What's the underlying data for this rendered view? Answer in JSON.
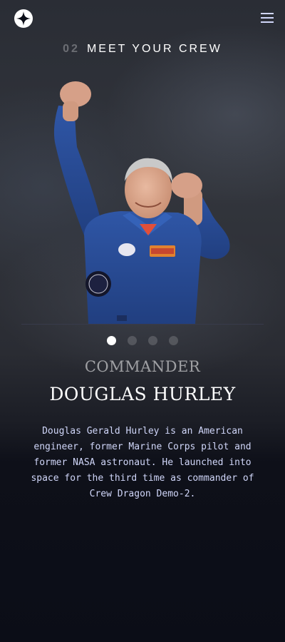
{
  "header": {
    "logo_icon": "star-logo-icon",
    "menu_icon": "hamburger-menu-icon"
  },
  "section": {
    "number": "02",
    "title": "MEET YOUR CREW"
  },
  "crew": {
    "image_alt": "crew-member-photo",
    "role": "COMMANDER",
    "name": "DOUGLAS HURLEY",
    "bio": "Douglas Gerald Hurley is an American engineer, former Marine Corps pilot and former NASA astronaut. He launched into space for the third time as commander of Crew Dragon Demo-2.",
    "total_members": 4,
    "active_index": 0
  },
  "colors": {
    "background": "#0b0d17",
    "accent_text": "#d0d6f9",
    "dot_inactive": "rgba(255,255,255,0.17)",
    "dot_active": "#ffffff",
    "suit_blue": "#2b4f9b"
  }
}
